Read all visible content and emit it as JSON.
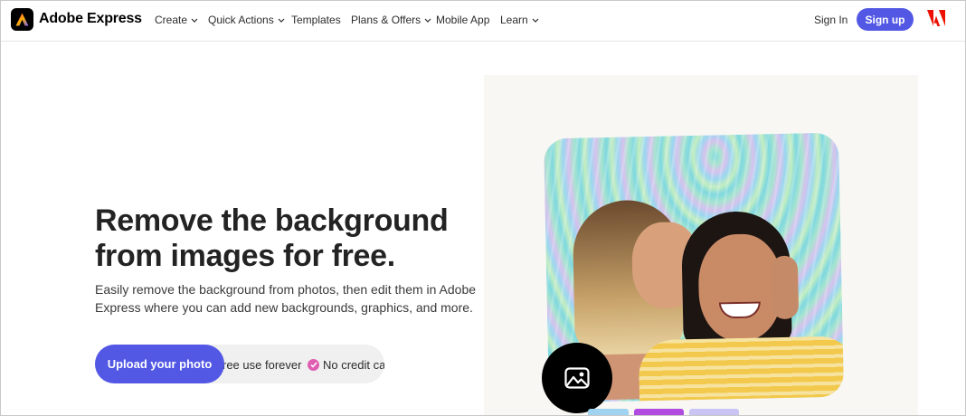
{
  "header": {
    "brand": "Adobe Express",
    "nav": [
      {
        "label": "Create",
        "dropdown": true
      },
      {
        "label": "Quick Actions",
        "dropdown": true
      },
      {
        "label": "Templates",
        "dropdown": false
      },
      {
        "label": "Plans & Offers",
        "dropdown": true
      },
      {
        "label": "Mobile App",
        "dropdown": false
      },
      {
        "label": "Learn",
        "dropdown": true
      }
    ],
    "sign_in": "Sign In",
    "sign_up": "Sign up"
  },
  "hero": {
    "title": "Remove the background from images for free.",
    "subtitle": "Easily remove the background from photos, then edit them in Adobe Express where you can add new backgrounds, graphics, and more.",
    "upload_button": "Upload your photo",
    "perk_1": "ree use forever",
    "perk_2": "No credit card"
  },
  "colors": {
    "accent": "#5258e4",
    "check": "#e05eb2"
  },
  "icons": {
    "logo": "adobe-express-logo-icon",
    "adobe": "adobe-logo-icon",
    "image": "image-icon"
  }
}
